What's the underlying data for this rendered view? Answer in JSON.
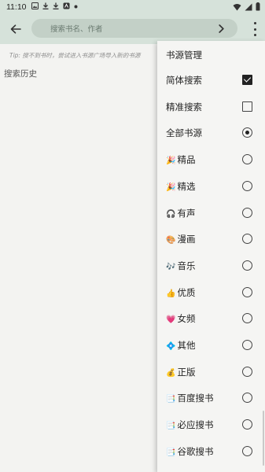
{
  "status_bar": {
    "time": "11:10",
    "icons": [
      "image-icon",
      "download-icon",
      "download-icon",
      "app-icon",
      "dot-icon"
    ],
    "right_icons": [
      "wifi-icon",
      "signal-icon",
      "battery-icon"
    ]
  },
  "toolbar": {
    "search_placeholder": "搜索书名、作者"
  },
  "tip": "Tip: 搜不到书时，尝试进入书源广场导入新的书源",
  "history_label": "搜索历史",
  "menu": {
    "title": "书源管理",
    "items": [
      {
        "label": "简体搜索",
        "emoji": "",
        "control": "checkbox",
        "checked": true
      },
      {
        "label": "精准搜索",
        "emoji": "",
        "control": "checkbox",
        "checked": false
      },
      {
        "label": "全部书源",
        "emoji": "",
        "control": "radio",
        "checked": true
      },
      {
        "label": "精品",
        "emoji": "🎉",
        "control": "radio",
        "checked": false
      },
      {
        "label": "精选",
        "emoji": "🎉",
        "control": "radio",
        "checked": false
      },
      {
        "label": "有声",
        "emoji": "🎧",
        "control": "radio",
        "checked": false
      },
      {
        "label": "漫画",
        "emoji": "🎨",
        "control": "radio",
        "checked": false
      },
      {
        "label": "音乐",
        "emoji": "🎶",
        "control": "radio",
        "checked": false
      },
      {
        "label": "优质",
        "emoji": "👍",
        "control": "radio",
        "checked": false
      },
      {
        "label": "女频",
        "emoji": "💗",
        "control": "radio",
        "checked": false
      },
      {
        "label": "其他",
        "emoji": "💠",
        "control": "radio",
        "checked": false
      },
      {
        "label": "正版",
        "emoji": "💰",
        "control": "radio",
        "checked": false
      },
      {
        "label": "百度搜书",
        "emoji": "📑",
        "control": "radio",
        "checked": false
      },
      {
        "label": "必应搜书",
        "emoji": "📑",
        "control": "radio",
        "checked": false
      },
      {
        "label": "谷歌搜书",
        "emoji": "📑",
        "control": "radio",
        "checked": false
      }
    ]
  }
}
